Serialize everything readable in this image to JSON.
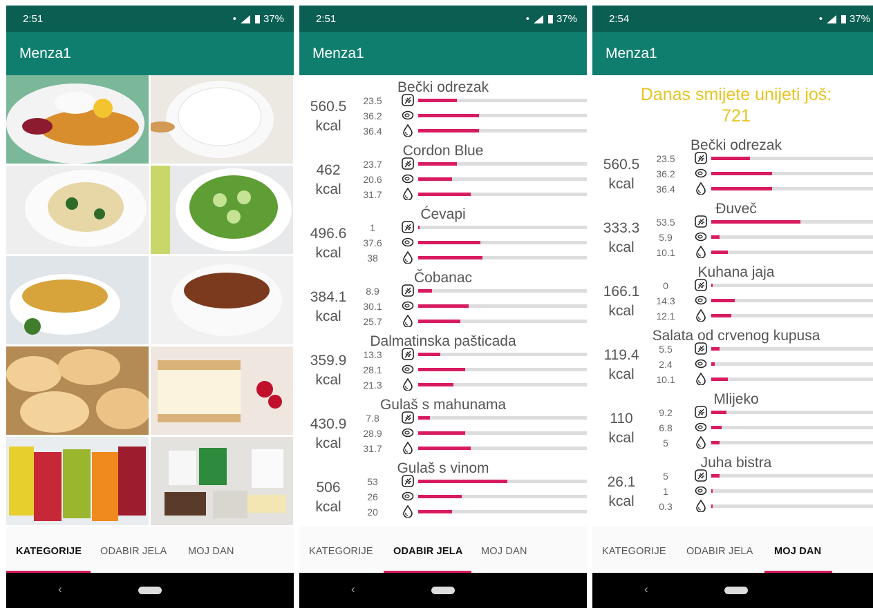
{
  "colors": {
    "status_bar": "#0b5e52",
    "app_bar": "#107e6f",
    "accent": "#d81b60",
    "remaining": "#e8c322"
  },
  "status": {
    "times": [
      "2:51",
      "2:51",
      "2:54"
    ],
    "battery": "37%",
    "signal": "R"
  },
  "app": {
    "title": "Menza1"
  },
  "tabs": [
    "KATEGORIJE",
    "ODABIR JELA",
    "MOJ DAN"
  ],
  "categories": [
    "schnitzel-image",
    "rice-image",
    "pasta-image",
    "cucumber-salad-image",
    "soup-image",
    "stew-image",
    "bread-rolls-image",
    "cake-image",
    "juice-image",
    "dairy-image"
  ],
  "nutrient_icons": [
    "grain-icon",
    "meat-icon",
    "drop-icon"
  ],
  "odabir": {
    "items": [
      {
        "name": "Bečki odrezak",
        "kcal": "560.5",
        "unit": "kcal",
        "values": [
          "23.5",
          "36.2",
          "36.4"
        ],
        "ratios": [
          0.23,
          0.36,
          0.36
        ]
      },
      {
        "name": "Cordon Blue",
        "kcal": "462",
        "unit": "kcal",
        "values": [
          "23.7",
          "20.6",
          "31.7"
        ],
        "ratios": [
          0.23,
          0.2,
          0.31
        ]
      },
      {
        "name": "Ćevapi",
        "kcal": "496.6",
        "unit": "kcal",
        "values": [
          "1",
          "37.6",
          "38"
        ],
        "ratios": [
          0.01,
          0.37,
          0.38
        ]
      },
      {
        "name": "Čobanac",
        "kcal": "384.1",
        "unit": "kcal",
        "values": [
          "8.9",
          "30.1",
          "25.7"
        ],
        "ratios": [
          0.08,
          0.3,
          0.25
        ]
      },
      {
        "name": "Dalmatinska pašticada",
        "kcal": "359.9",
        "unit": "kcal",
        "values": [
          "13.3",
          "28.1",
          "21.3"
        ],
        "ratios": [
          0.13,
          0.28,
          0.21
        ]
      },
      {
        "name": "Gulaš s mahunama",
        "kcal": "430.9",
        "unit": "kcal",
        "values": [
          "7.8",
          "28.9",
          "31.7"
        ],
        "ratios": [
          0.07,
          0.28,
          0.31
        ]
      },
      {
        "name": "Gulaš s vinom",
        "kcal": "506",
        "unit": "kcal",
        "values": [
          "53",
          "26",
          "20"
        ],
        "ratios": [
          0.53,
          0.26,
          0.2
        ]
      }
    ]
  },
  "moj_dan": {
    "remaining_label": "Danas smijete unijeti još:",
    "remaining_value": "721",
    "items": [
      {
        "name": "Bečki odrezak",
        "kcal": "560.5",
        "unit": "kcal",
        "values": [
          "23.5",
          "36.2",
          "36.4"
        ],
        "ratios": [
          0.23,
          0.36,
          0.36
        ]
      },
      {
        "name": "Đuveč",
        "kcal": "333.3",
        "unit": "kcal",
        "values": [
          "53.5",
          "5.9",
          "10.1"
        ],
        "ratios": [
          0.53,
          0.05,
          0.1
        ]
      },
      {
        "name": "Kuhana jaja",
        "kcal": "166.1",
        "unit": "kcal",
        "values": [
          "0",
          "14.3",
          "12.1"
        ],
        "ratios": [
          0.0,
          0.14,
          0.12
        ]
      },
      {
        "name": "Salata od crvenog kupusa",
        "kcal": "119.4",
        "unit": "kcal",
        "values": [
          "5.5",
          "2.4",
          "10.1"
        ],
        "ratios": [
          0.05,
          0.02,
          0.1
        ]
      },
      {
        "name": "Mlijeko",
        "kcal": "110",
        "unit": "kcal",
        "values": [
          "9.2",
          "6.8",
          "5"
        ],
        "ratios": [
          0.09,
          0.06,
          0.05
        ]
      },
      {
        "name": "Juha bistra",
        "kcal": "26.1",
        "unit": "kcal",
        "values": [
          "5",
          "1",
          "0.3"
        ],
        "ratios": [
          0.05,
          0.01,
          0.0
        ]
      }
    ]
  }
}
